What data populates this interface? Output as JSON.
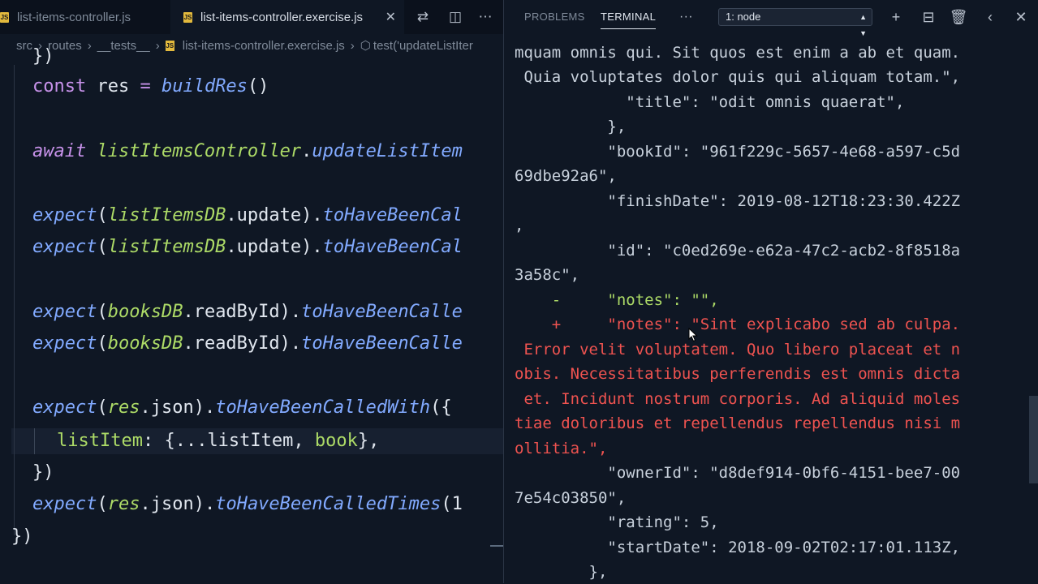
{
  "editor": {
    "tabs": [
      {
        "label": "list-items-controller.js",
        "icon": "js-icon",
        "active": false
      },
      {
        "label": "list-items-controller.exercise.js",
        "icon": "js-icon",
        "active": true
      }
    ],
    "toolbar_icons": [
      "compare-icon",
      "split-editor-icon",
      "more-icon"
    ],
    "breadcrumb": [
      "src",
      "routes",
      "__tests__",
      "list-items-controller.exercise.js",
      "test('updateListIter"
    ],
    "code": {
      "l0": "})",
      "l1a": "const",
      "l1b": " res ",
      "l1c": "=",
      "l1d": " buildRes",
      "l1e": "()",
      "l2a": "await",
      "l2b": " listItemsController",
      "l2c": ".",
      "l2d": "updateListItem",
      "l3a": "expect",
      "l3b": "(",
      "l3c": "listItemsDB",
      "l3d": ".update).",
      "l3e": "toHaveBeenCal",
      "l4a": "expect",
      "l4b": "(",
      "l4c": "listItemsDB",
      "l4d": ".update).",
      "l4e": "toHaveBeenCal",
      "l5a": "expect",
      "l5b": "(",
      "l5c": "booksDB",
      "l5d": ".readById).",
      "l5e": "toHaveBeenCalle",
      "l6a": "expect",
      "l6b": "(",
      "l6c": "booksDB",
      "l6d": ".readById).",
      "l6e": "toHaveBeenCalle",
      "l7a": "expect",
      "l7b": "(",
      "l7c": "res",
      "l7d": ".json).",
      "l7e": "toHaveBeenCalledWith",
      "l7f": "({",
      "l8a": "listItem",
      "l8b": ": {...listItem, ",
      "l8c": "book",
      "l8d": "},",
      "l9": "})",
      "l10a": "expect",
      "l10b": "(",
      "l10c": "res",
      "l10d": ".json).",
      "l10e": "toHaveBeenCalledTimes",
      "l10f": "(1",
      "l11": "})"
    }
  },
  "panel": {
    "tabs": [
      "PROBLEMS",
      "TERMINAL"
    ],
    "more": "···",
    "terminal_select": "1: node",
    "icons": [
      "plus-icon",
      "split-icon",
      "trash-icon",
      "chevron-left-icon",
      "close-icon"
    ],
    "lines": [
      "mquam omnis qui. Sit quos est enim a ab et quam.",
      " Quia voluptates dolor quis qui aliquam totam.\",",
      "            \"title\": \"odit omnis quaerat\",",
      "          },",
      "          \"bookId\": \"961f229c-5657-4e68-a597-c5d",
      "69dbe92a6\",",
      "          \"finishDate\": 2019-08-12T18:23:30.422Z",
      ",",
      "          \"id\": \"c0ed269e-e62a-47c2-acb2-8f8518a",
      "3a58c\",",
      "    -     \"notes\": \"\",",
      "    +     \"notes\": \"Sint explicabo sed ab culpa.",
      " Error velit voluptatem. Quo libero placeat et n",
      "obis. Necessitatibus perferendis est omnis dicta",
      " et. Incidunt nostrum corporis. Ad aliquid moles",
      "tiae doloribus et repellendus repellendus nisi m",
      "ollitia.\",",
      "          \"ownerId\": \"d8def914-0bf6-4151-bee7-00",
      "7e54c03850\",",
      "          \"rating\": 5,",
      "          \"startDate\": 2018-09-02T02:17:01.113Z,",
      "        },"
    ]
  },
  "colors": {
    "background": "#0f1724",
    "diff_removed": "#addb67",
    "diff_added": "#ef5350",
    "keyword": "#c792ea",
    "function": "#82aaff"
  }
}
